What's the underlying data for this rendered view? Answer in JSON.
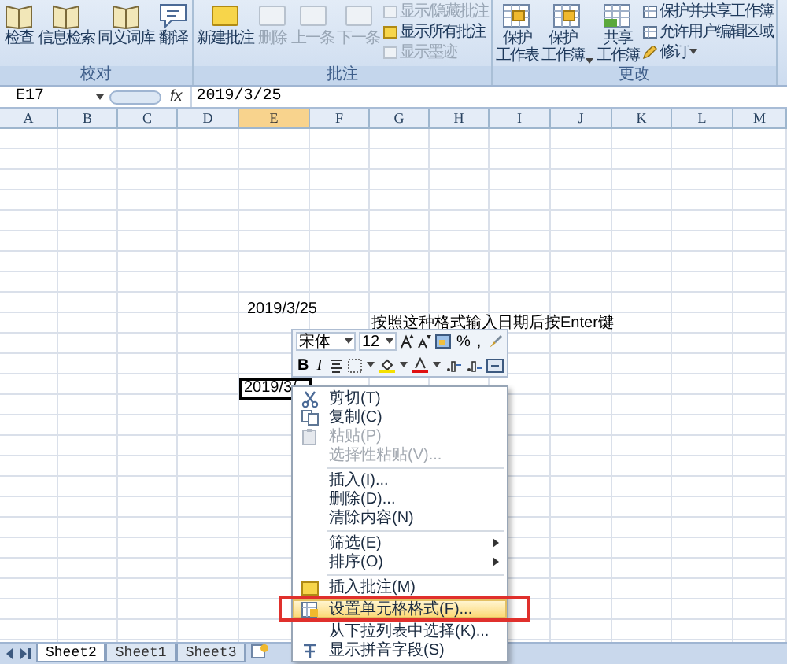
{
  "ribbon": {
    "groups": [
      {
        "label": "校对",
        "large_buttons": [
          {
            "label": "检查",
            "disabled": false
          },
          {
            "label": "信息检索",
            "disabled": false
          },
          {
            "label": "同义词库",
            "disabled": false
          },
          {
            "label": "翻译",
            "disabled": false
          }
        ]
      },
      {
        "label": "批注",
        "large_buttons": [
          {
            "label": "新建批注",
            "disabled": false
          },
          {
            "label": "删除",
            "disabled": true
          },
          {
            "label": "上一条",
            "disabled": true
          },
          {
            "label": "下一条",
            "disabled": true
          }
        ],
        "small_buttons": [
          {
            "label": "显示/隐藏批注",
            "disabled": true
          },
          {
            "label": "显示所有批注",
            "disabled": false
          },
          {
            "label": "显示墨迹",
            "disabled": true
          }
        ]
      },
      {
        "label": "更改",
        "large_buttons": [
          {
            "lines": [
              "保护",
              "工作表"
            ],
            "disabled": false,
            "dropdown": false
          },
          {
            "lines": [
              "保护",
              "工作簿"
            ],
            "disabled": false,
            "dropdown": true
          },
          {
            "lines": [
              "共享",
              "工作簿"
            ],
            "disabled": false,
            "dropdown": false
          }
        ],
        "small_buttons": [
          {
            "label": "保护并共享工作簿",
            "disabled": false,
            "dropdown": false
          },
          {
            "label": "允许用户编辑区域",
            "disabled": false,
            "dropdown": false
          },
          {
            "label": "修订",
            "disabled": false,
            "dropdown": true
          }
        ]
      }
    ]
  },
  "formula_bar": {
    "name_box": "E17",
    "fx_label": "fx",
    "formula": "2019/3/25"
  },
  "columns": [
    {
      "label": "A",
      "selected": false
    },
    {
      "label": "B",
      "selected": false
    },
    {
      "label": "C",
      "selected": false
    },
    {
      "label": "D",
      "selected": false
    },
    {
      "label": "E",
      "selected": true
    },
    {
      "label": "F",
      "selected": false
    },
    {
      "label": "G",
      "selected": false
    },
    {
      "label": "H",
      "selected": false
    },
    {
      "label": "I",
      "selected": false
    },
    {
      "label": "J",
      "selected": false
    },
    {
      "label": "K",
      "selected": false
    },
    {
      "label": "L",
      "selected": false
    },
    {
      "label": "M",
      "selected": false
    }
  ],
  "cells": [
    {
      "text": "2019/3/25"
    },
    {
      "text": "按照这种格式输入日期后按Enter键"
    }
  ],
  "active_cell": {
    "text": "2019/3/"
  },
  "mini_toolbar": {
    "font": "宋体",
    "size": "12",
    "percent": "%",
    "comma": ",",
    "bold": "B",
    "italic": "I"
  },
  "context_menu": {
    "items": [
      {
        "kind": "item",
        "label": "剪切(T)",
        "disabled": false,
        "selected": false,
        "submenu": false,
        "annotated": false
      },
      {
        "kind": "item",
        "label": "复制(C)",
        "disabled": false,
        "selected": false,
        "submenu": false,
        "annotated": false
      },
      {
        "kind": "item",
        "label": "粘贴(P)",
        "disabled": true,
        "selected": false,
        "submenu": false,
        "annotated": false
      },
      {
        "kind": "item",
        "label": "选择性粘贴(V)...",
        "disabled": true,
        "selected": false,
        "submenu": false,
        "annotated": false
      },
      {
        "kind": "separator"
      },
      {
        "kind": "item",
        "label": "插入(I)...",
        "disabled": false,
        "selected": false,
        "submenu": false,
        "annotated": false
      },
      {
        "kind": "item",
        "label": "删除(D)...",
        "disabled": false,
        "selected": false,
        "submenu": false,
        "annotated": false
      },
      {
        "kind": "item",
        "label": "清除内容(N)",
        "disabled": false,
        "selected": false,
        "submenu": false,
        "annotated": false
      },
      {
        "kind": "separator"
      },
      {
        "kind": "item",
        "label": "筛选(E)",
        "disabled": false,
        "selected": false,
        "submenu": true,
        "annotated": false
      },
      {
        "kind": "item",
        "label": "排序(O)",
        "disabled": false,
        "selected": false,
        "submenu": true,
        "annotated": false
      },
      {
        "kind": "separator"
      },
      {
        "kind": "item",
        "label": "插入批注(M)",
        "disabled": false,
        "selected": false,
        "submenu": false,
        "annotated": false
      },
      {
        "kind": "item",
        "label": "设置单元格格式(F)...",
        "disabled": false,
        "selected": true,
        "submenu": false,
        "annotated": true
      },
      {
        "kind": "item",
        "label": "从下拉列表中选择(K)...",
        "disabled": false,
        "selected": false,
        "submenu": false,
        "annotated": false
      },
      {
        "kind": "item",
        "label": "显示拼音字段(S)",
        "disabled": false,
        "selected": false,
        "submenu": false,
        "annotated": false
      }
    ]
  },
  "sheet_tabs": [
    {
      "label": "Sheet2",
      "selected": true
    },
    {
      "label": "Sheet1",
      "selected": false
    },
    {
      "label": "Sheet3",
      "selected": false
    }
  ]
}
